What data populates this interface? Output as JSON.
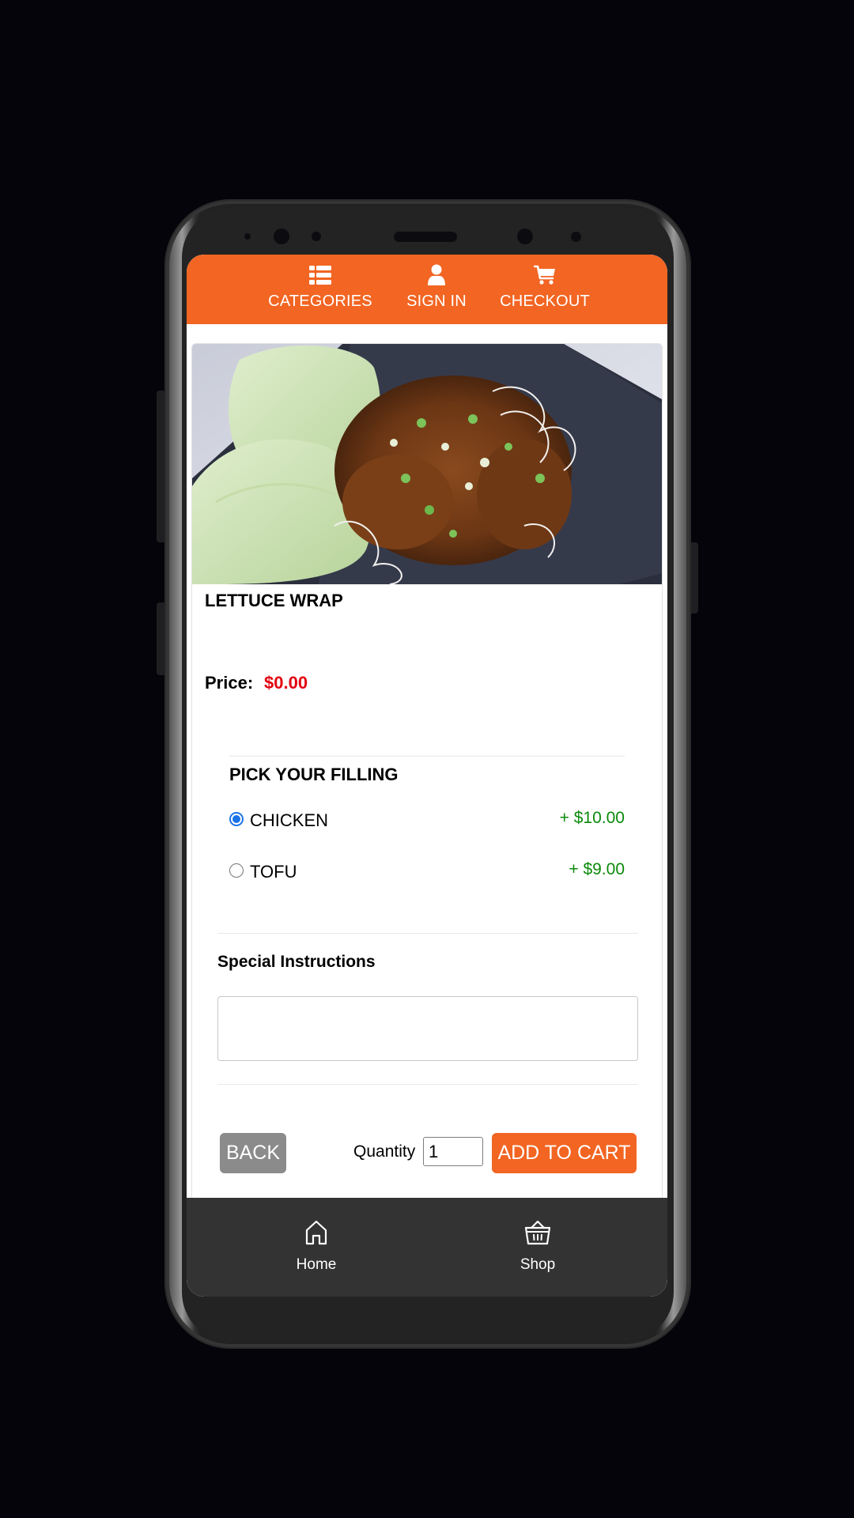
{
  "device": {
    "frame": "smartphone"
  },
  "topnav": {
    "items": [
      {
        "icon": "list-icon",
        "label": "CATEGORIES"
      },
      {
        "icon": "user-icon",
        "label": "SIGN IN"
      },
      {
        "icon": "cart-icon",
        "label": "CHECKOUT"
      }
    ],
    "background": "#f26522"
  },
  "product": {
    "image_alt": "Lettuce wrap with minced filling, scallions and crispy rice noodles on a dark plate",
    "title": "LETTUCE WRAP",
    "price_label": "Price:",
    "price_value": "$0.00",
    "price_color": "#e3000f"
  },
  "filling": {
    "title": "PICK YOUR FILLING",
    "options": [
      {
        "label": "CHICKEN",
        "price": "+ $10.00",
        "selected": true
      },
      {
        "label": "TOFU",
        "price": "+ $9.00",
        "selected": false
      }
    ],
    "price_color": "#0b8a0b"
  },
  "instructions": {
    "title": "Special Instructions",
    "value": "",
    "placeholder": ""
  },
  "actions": {
    "back_label": "BACK",
    "quantity_label": "Quantity",
    "quantity_value": "1",
    "add_to_cart_label": "ADD TO CART"
  },
  "bottomnav": {
    "items": [
      {
        "icon": "home-icon",
        "label": "Home"
      },
      {
        "icon": "basket-icon",
        "label": "Shop"
      }
    ]
  }
}
